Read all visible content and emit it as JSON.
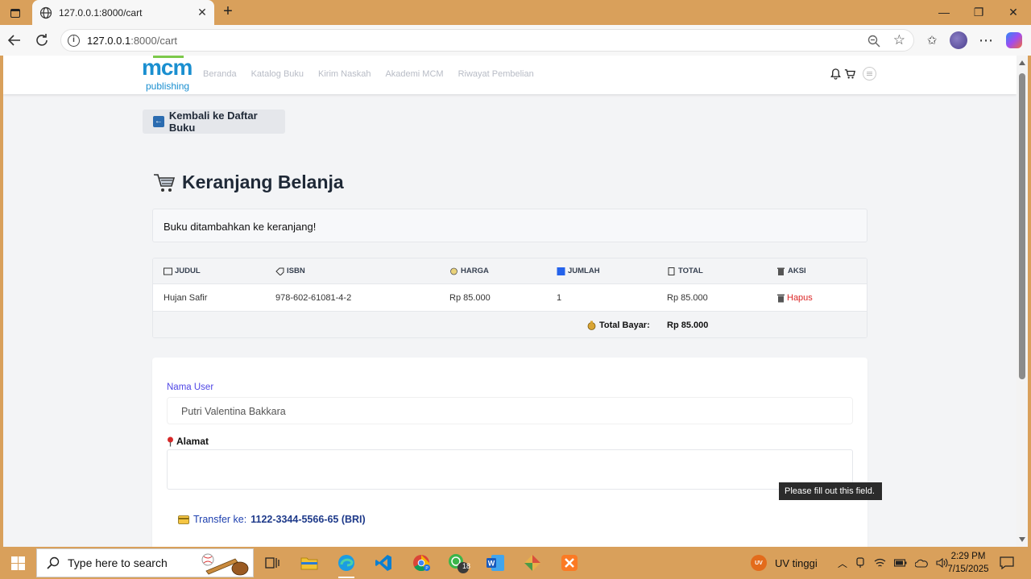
{
  "browser": {
    "tab_title": "127.0.0.1:8000/cart",
    "url_host": "127.0.0.1",
    "url_path": ":8000/cart"
  },
  "site": {
    "logo_text": "mcm",
    "logo_sub": "publishing",
    "menu": [
      "Beranda",
      "Katalog Buku",
      "Kirim Naskah",
      "Akademi MCM",
      "Riwayat Pembelian"
    ]
  },
  "page": {
    "back_label": "Kembali ke Daftar Buku",
    "title": "Keranjang Belanja",
    "alert": "Buku ditambahkan ke keranjang!"
  },
  "cart_table": {
    "headers": [
      "JUDUL",
      "ISBN",
      "HARGA",
      "JUMLAH",
      "TOTAL",
      "AKSI"
    ],
    "rows": [
      {
        "judul": "Hujan Safir",
        "isbn": "978-602-61081-4-2",
        "harga": "Rp 85.000",
        "jumlah": "1",
        "total": "Rp 85.000",
        "aksi": "Hapus"
      }
    ],
    "total_label": "Total Bayar:",
    "total_value": "Rp 85.000"
  },
  "form": {
    "user_label": "Nama User",
    "user_value": "Putri Valentina Bakkara",
    "address_label": "Alamat",
    "address_value": "",
    "transfer_prefix": "Transfer ke:",
    "transfer_account": "1122-3344-5566-65 (BRI)",
    "validation_tooltip": "Please fill out this field."
  },
  "taskbar": {
    "search_placeholder": "Type here to search",
    "weather": "UV tinggi",
    "weather_badge": "UV",
    "chat_badge": "18",
    "time": "2:29 PM",
    "date": "7/15/2025"
  },
  "colors": {
    "frame": "#d9a05b",
    "brand": "#1a8fd0",
    "danger": "#dc2626",
    "link": "#1e40af",
    "label_indigo": "#4f46e5"
  }
}
